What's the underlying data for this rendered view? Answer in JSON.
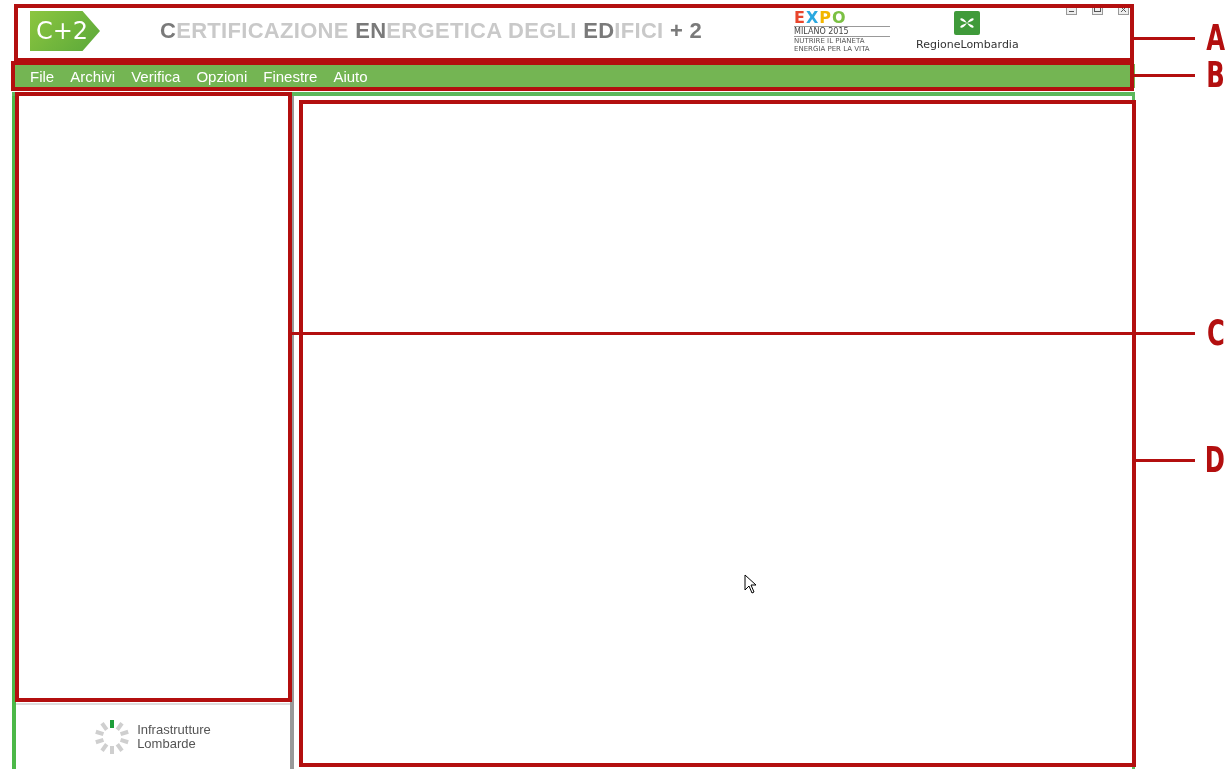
{
  "window": {
    "logo": "C+2",
    "title": "**C**ERTIFICAZIONE **EN**ERGETICA DEGLI **ED**IFICI **+ 2**",
    "expo_logo": {
      "word": [
        "E",
        "X",
        "P",
        "O"
      ],
      "city": "MILANO 2015",
      "motto": [
        "NUTRIRE IL PIANETA",
        "ENERGIA PER LA VITA"
      ]
    },
    "region_logo": "RegioneLombardia"
  },
  "menu": [
    "File",
    "Archivi",
    "Verifica",
    "Opzioni",
    "Finestre",
    "Aiuto"
  ],
  "sidebar_footer": {
    "lines": [
      "Infrastrutture",
      "Lombarde"
    ]
  },
  "callouts": [
    {
      "label": "A"
    },
    {
      "label": "B"
    },
    {
      "label": "C"
    },
    {
      "label": "D"
    }
  ]
}
